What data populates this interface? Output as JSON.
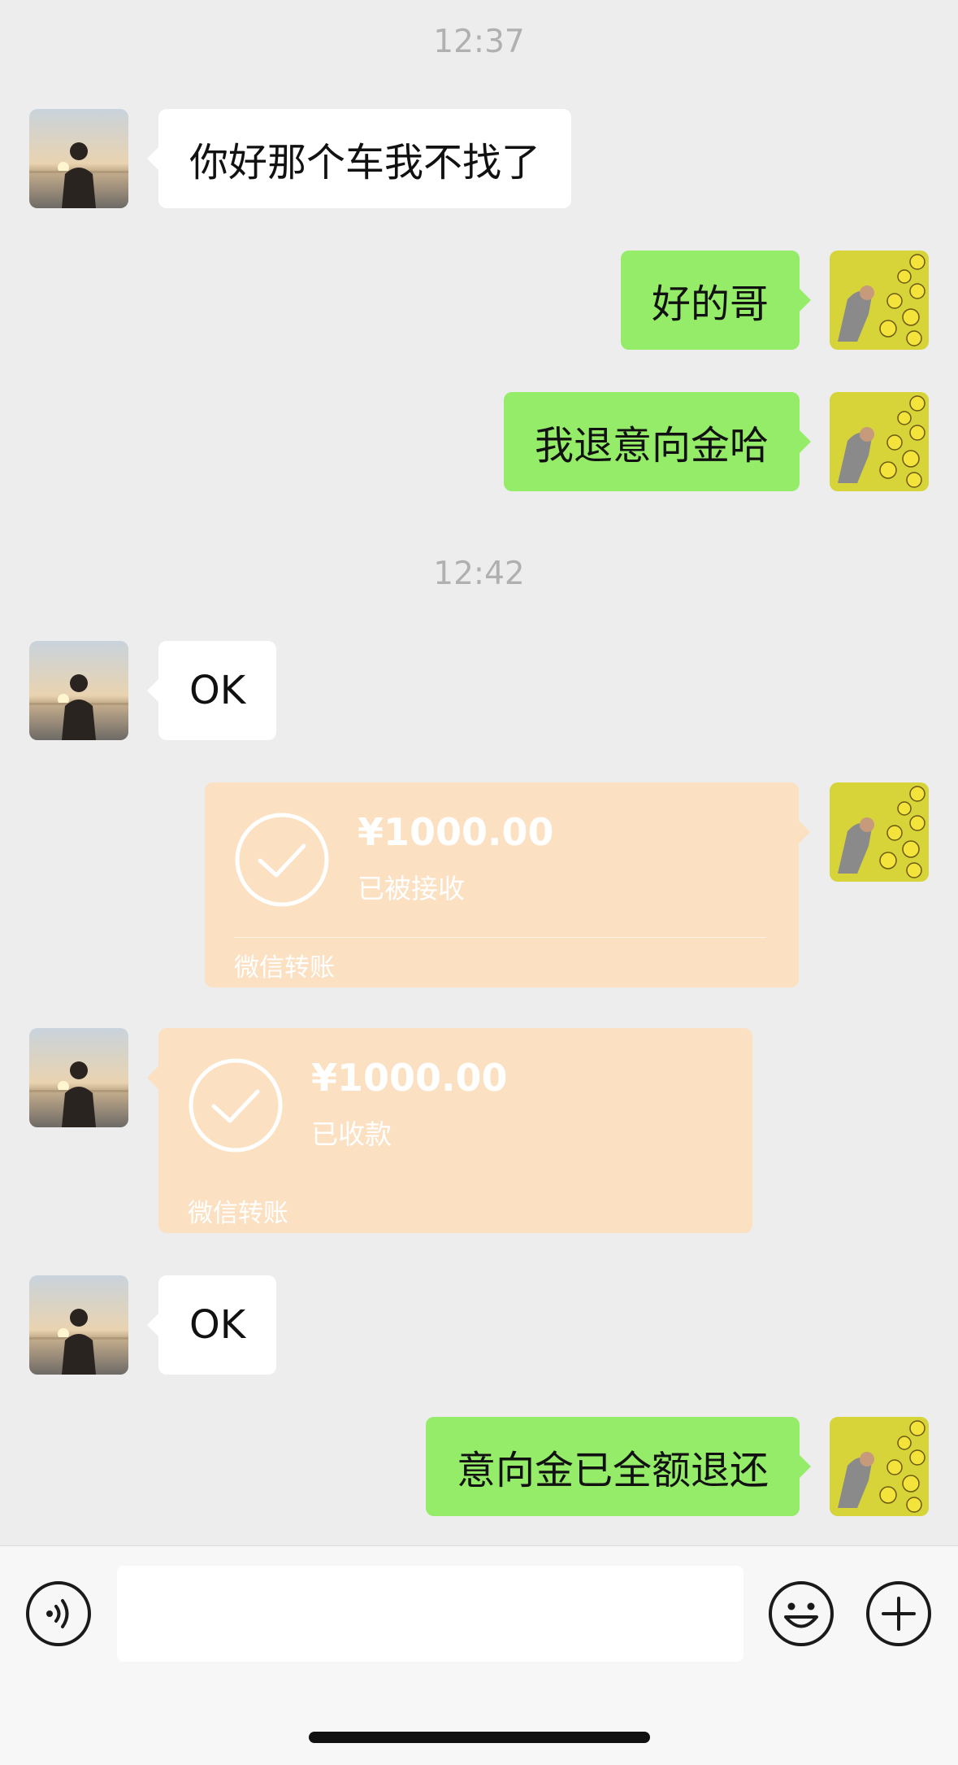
{
  "messages": {
    "time1": "12:37",
    "m1": "你好那个车我不找了",
    "m2": "好的哥",
    "m3": "我退意向金哈",
    "time2": "12:42",
    "m4": "OK",
    "t1": {
      "amount": "¥1000.00",
      "status": "已被接收",
      "label": "微信转账"
    },
    "t2": {
      "amount": "¥1000.00",
      "status": "已收款",
      "label": "微信转账"
    },
    "m5": "OK",
    "m6": "意向金已全额退还"
  },
  "input": {
    "value": "",
    "placeholder": ""
  },
  "icons": {
    "voice": "voice-icon",
    "emoji": "emoji-icon",
    "plus": "plus-icon",
    "transfer_check": "check-circle-icon"
  },
  "colors": {
    "background": "#ededed",
    "incoming_bubble": "#ffffff",
    "outgoing_bubble": "#95ec69",
    "transfer_card": "#fbe0c1",
    "timestamp": "#b0b0b0"
  }
}
